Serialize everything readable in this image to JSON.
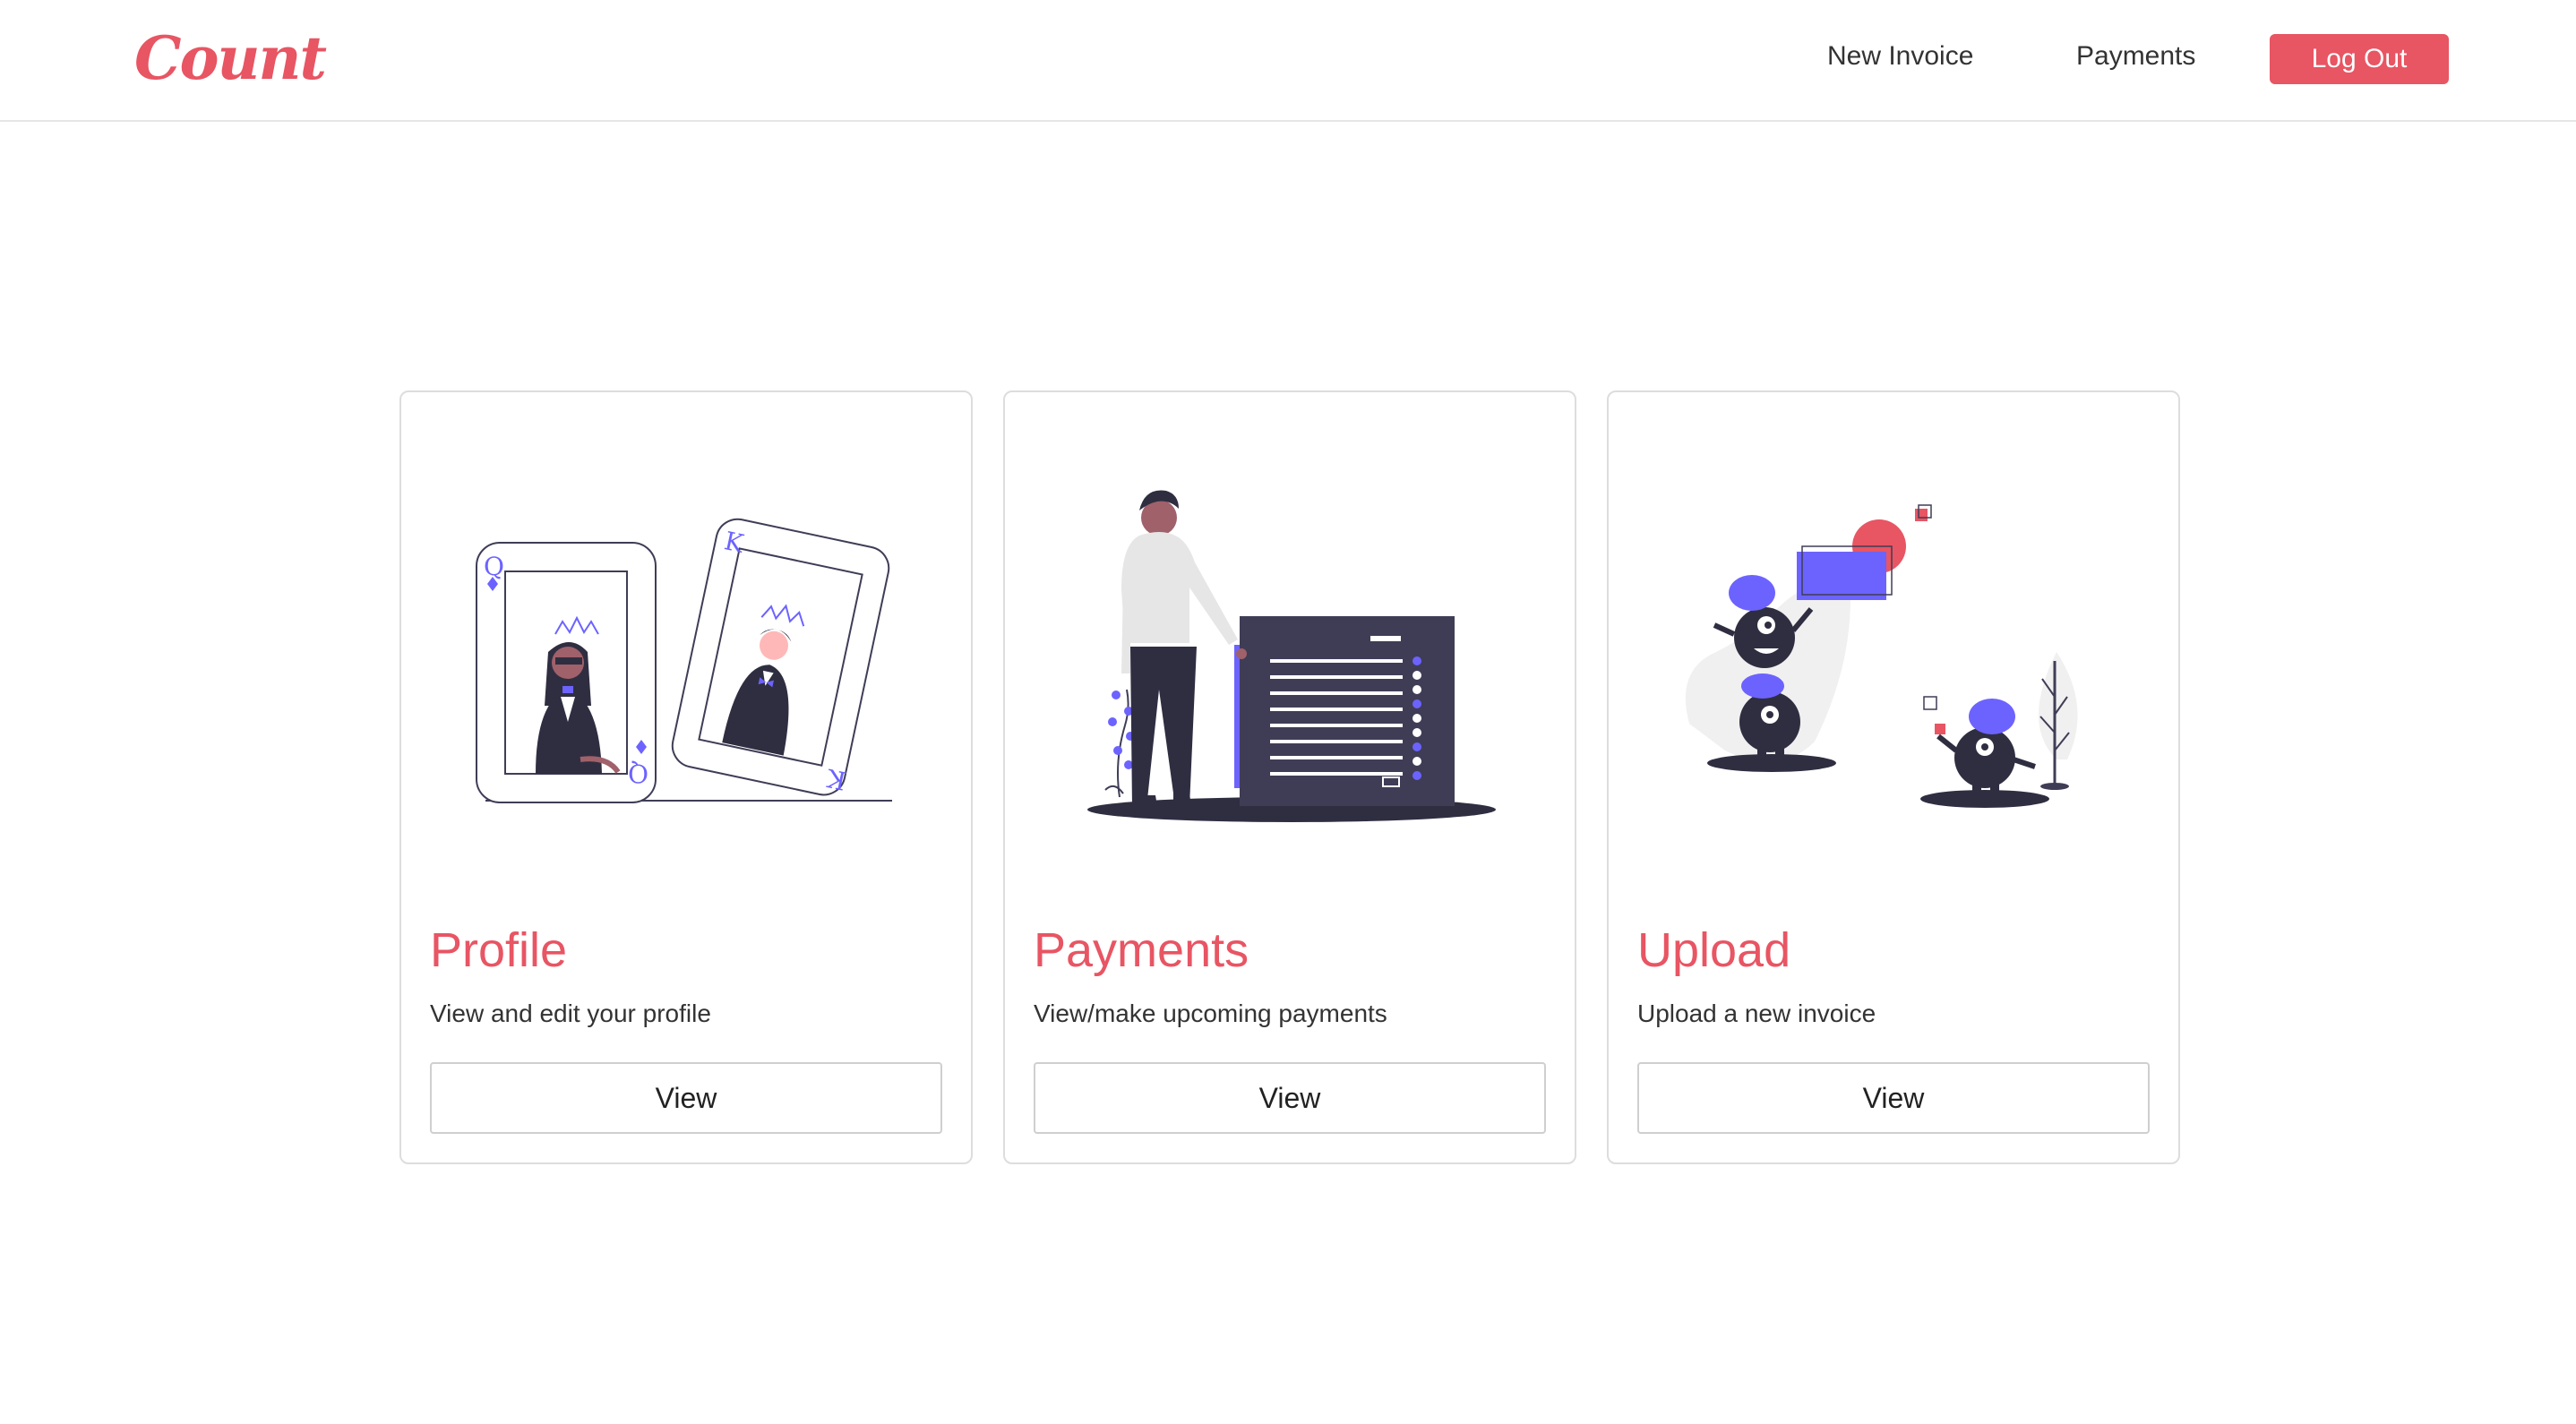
{
  "brand": {
    "name": "Count",
    "color": "#e85563"
  },
  "nav": {
    "new_invoice": "New Invoice",
    "payments": "Payments",
    "logout": "Log Out"
  },
  "colors": {
    "accent": "#e85563",
    "illustration_purple": "#6c63ff",
    "illustration_dark": "#3f3d56"
  },
  "cards": [
    {
      "title": "Profile",
      "text": "View and edit your profile",
      "button": "View",
      "illustration": "playing-cards-king-queen"
    },
    {
      "title": "Payments",
      "text": "View/make upcoming payments",
      "button": "View",
      "illustration": "man-with-checklist"
    },
    {
      "title": "Upload",
      "text": "Upload a new invoice",
      "button": "View",
      "illustration": "monsters-with-shapes"
    }
  ]
}
